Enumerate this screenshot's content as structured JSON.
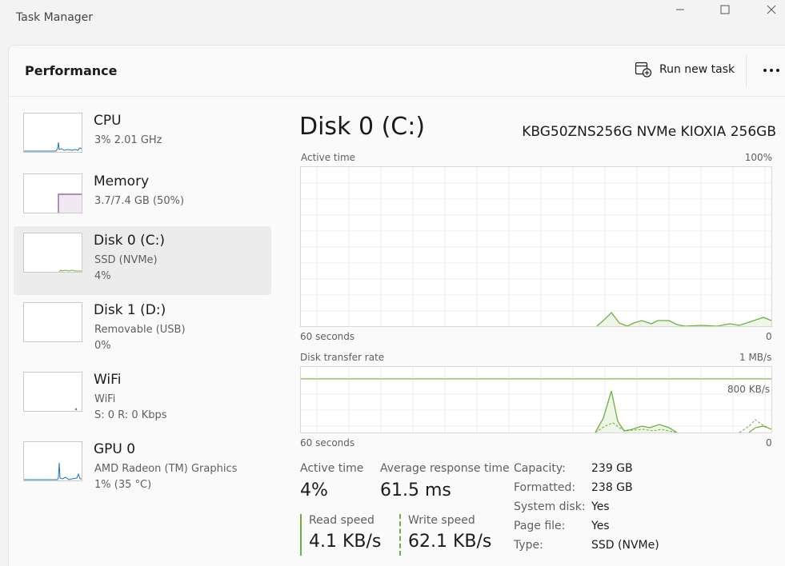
{
  "window": {
    "title": "Task Manager"
  },
  "header": {
    "page_title": "Performance",
    "run_new_task_label": "Run new task"
  },
  "sidebar": {
    "items": [
      {
        "name": "CPU",
        "sub1": "3%  2.01 GHz",
        "sub2": ""
      },
      {
        "name": "Memory",
        "sub1": "3.7/7.4 GB (50%)",
        "sub2": ""
      },
      {
        "name": "Disk 0 (C:)",
        "sub1": "SSD (NVMe)",
        "sub2": "4%"
      },
      {
        "name": "Disk 1 (D:)",
        "sub1": "Removable (USB)",
        "sub2": "0%"
      },
      {
        "name": "WiFi",
        "sub1": "WiFi",
        "sub2": "S: 0 R: 0 Kbps"
      },
      {
        "name": "GPU 0",
        "sub1": "AMD Radeon (TM) Graphics",
        "sub2": "1%  (35 °C)"
      }
    ]
  },
  "main": {
    "title": "Disk 0 (C:)",
    "model": "KBG50ZNS256G NVMe KIOXIA 256GB",
    "active_chart": {
      "label": "Active time",
      "max_label": "100%",
      "time_label": "60 seconds",
      "min_label": "0"
    },
    "transfer_chart": {
      "label": "Disk transfer rate",
      "max_label": "1 MB/s",
      "mid_label": "800 KB/s",
      "time_label": "60 seconds",
      "min_label": "0"
    },
    "stats": {
      "active_time_label": "Active time",
      "active_time_value": "4%",
      "avg_response_label": "Average response time",
      "avg_response_value": "61.5 ms",
      "read_speed_label": "Read speed",
      "read_speed_value": "4.1 KB/s",
      "write_speed_label": "Write speed",
      "write_speed_value": "62.1 KB/s"
    },
    "properties": [
      {
        "label": "Capacity:",
        "value": "239 GB"
      },
      {
        "label": "Formatted:",
        "value": "238 GB"
      },
      {
        "label": "System disk:",
        "value": "Yes"
      },
      {
        "label": "Page file:",
        "value": "Yes"
      },
      {
        "label": "Type:",
        "value": "SSD (NVMe)"
      }
    ]
  },
  "colors": {
    "disk_green": "#6fae3f",
    "cpu_blue": "#1e73b8",
    "memory_purple": "#8a4a9e",
    "accent_line": "#c9c9c9"
  },
  "icons": {
    "run_task": "run-task-icon",
    "more": "more-icon",
    "minimize": "minimize-icon",
    "maximize": "maximize-icon",
    "close": "close-icon"
  }
}
